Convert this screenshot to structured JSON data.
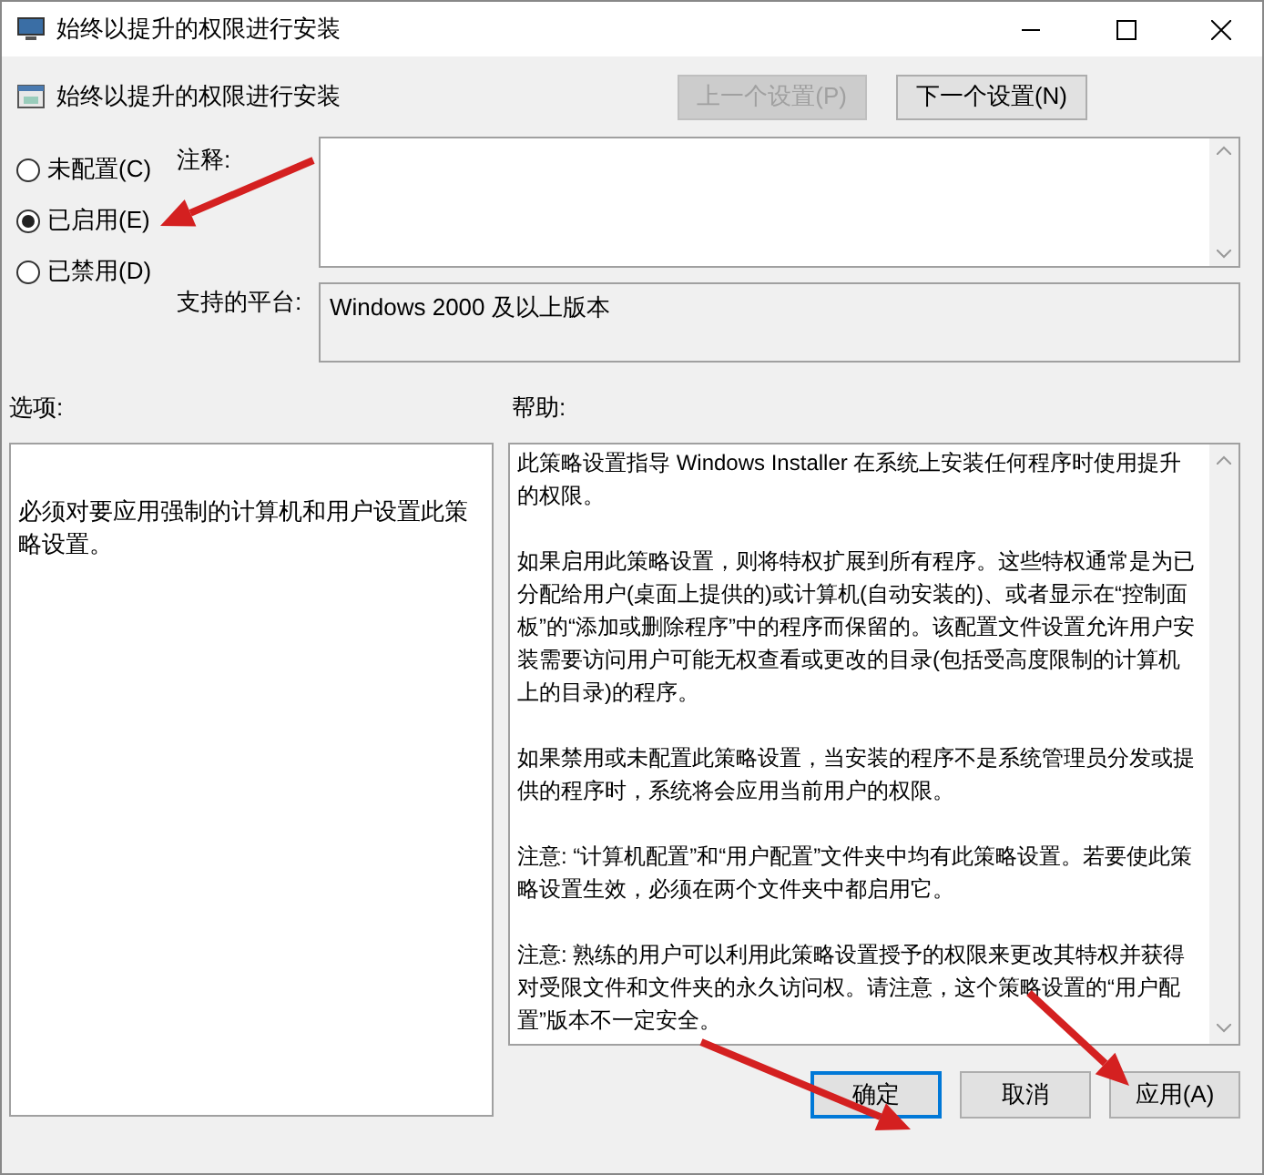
{
  "window": {
    "title": "始终以提升的权限进行安装"
  },
  "header": {
    "title": "始终以提升的权限进行安装",
    "buttons": [
      {
        "label": "上一个设置(P)",
        "disabled": true
      },
      {
        "label": "下一个设置(N)",
        "disabled": false
      }
    ]
  },
  "state_options": [
    {
      "label": "未配置(C)",
      "selected": false
    },
    {
      "label": "已启用(E)",
      "selected": true
    },
    {
      "label": "已禁用(D)",
      "selected": false
    }
  ],
  "comment": {
    "label": "注释:"
  },
  "platform": {
    "label": "支持的平台:",
    "value": "Windows 2000 及以上版本"
  },
  "options_label": "选项:",
  "help_label": "帮助:",
  "options_text": "必须对要应用强制的计算机和用户设置此策略设置。",
  "help_paragraphs": [
    "此策略设置指导 Windows Installer 在系统上安装任何程序时使用提升的权限。",
    "如果启用此策略设置，则将特权扩展到所有程序。这些特权通常是为已分配给用户(桌面上提供的)或计算机(自动安装的)、或者显示在“控制面板”的“添加或删除程序”中的程序而保留的。该配置文件设置允许用户安装需要访问用户可能无权查看或更改的目录(包括受高度限制的计算机上的目录)的程序。",
    "如果禁用或未配置此策略设置，当安装的程序不是系统管理员分发或提供的程序时，系统将会应用当前用户的权限。",
    "注意: “计算机配置”和“用户配置”文件夹中均有此策略设置。若要使此策略设置生效，必须在两个文件夹中都启用它。",
    "注意: 熟练的用户可以利用此策略设置授予的权限来更改其特权并获得对受限文件和文件夹的永久访问权。请注意，这个策略设置的“用户配置”版本不一定安全。"
  ],
  "footer_buttons": [
    {
      "label": "确定",
      "default": true
    },
    {
      "label": "取消",
      "default": false
    },
    {
      "label": "应用(A)",
      "default": false
    }
  ]
}
